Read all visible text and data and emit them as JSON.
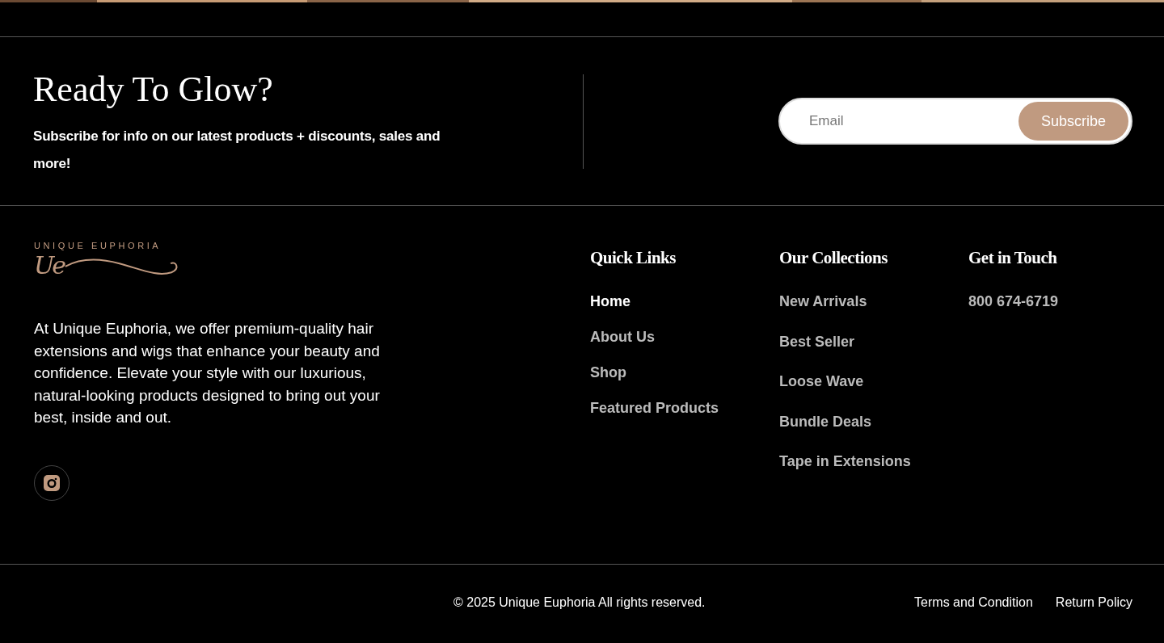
{
  "newsletter": {
    "title": "Ready To Glow?",
    "text": "Subscribe for info on our latest products + discounts, sales and more!",
    "email": {
      "placeholder": "Email"
    },
    "button": "Subscribe"
  },
  "brand": {
    "name": "UNIQUE EUPHORIA",
    "monogram": "Ue",
    "about": "At Unique Euphoria, we offer premium-quality hair extensions and wigs that enhance your beauty and confidence. Elevate your style with our luxurious, natural-looking products designed to bring out your best, inside and out."
  },
  "columns": [
    {
      "title": "Quick Links",
      "links": [
        {
          "label": "Home",
          "selected": true
        },
        {
          "label": "About Us",
          "selected": false
        },
        {
          "label": "Shop",
          "selected": false
        },
        {
          "label": "Featured Products",
          "selected": false
        }
      ]
    },
    {
      "title": "Our Collections",
      "links": [
        {
          "label": "New Arrivals",
          "selected": false
        },
        {
          "label": "Best Seller",
          "selected": false
        },
        {
          "label": "Loose Wave",
          "selected": false
        },
        {
          "label": "Bundle Deals",
          "selected": false
        },
        {
          "label": "Tape in Extensions",
          "selected": false
        }
      ]
    },
    {
      "title": "Get in Touch",
      "links": [
        {
          "label": "800 674-6719",
          "selected": false
        }
      ]
    }
  ],
  "bottom_bar": {
    "copyright": "© 2025 Unique Euphoria All rights reserved.",
    "links": [
      "Terms and Condition",
      "Return Policy"
    ]
  }
}
